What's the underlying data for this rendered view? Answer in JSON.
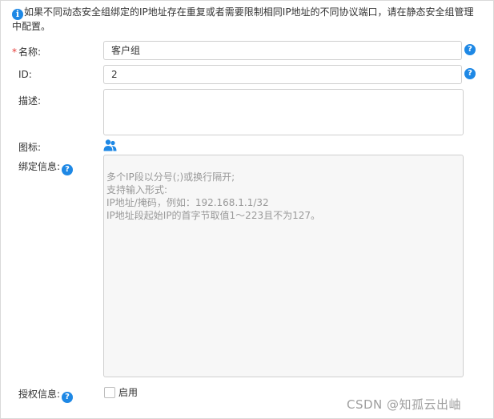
{
  "notice": {
    "text": "如果不同动态安全组绑定的IP地址存在重复或者需要限制相同IP地址的不同协议端口，请在静态安全组管理中配置。"
  },
  "form": {
    "name": {
      "required_mark": "*",
      "label": "名称:",
      "value": "客户组"
    },
    "id": {
      "label": "ID:",
      "value": "2"
    },
    "description": {
      "label": "描述:",
      "value": ""
    },
    "icon": {
      "label": "图标:",
      "icon_name": "user-group-icon"
    },
    "binding": {
      "label": "绑定信息:",
      "placeholder": "多个IP段以分号(;)或换行隔开;\n支持输入形式:\nIP地址/掩码，例如：192.168.1.1/32\nIP地址段起始IP的首字节取值1～223且不为127。"
    },
    "auth": {
      "label": "授权信息:",
      "checkbox_label": "启用",
      "checked": false
    }
  },
  "help_glyph": "?",
  "info_glyph": "i",
  "colors": {
    "accent": "#1e88e5",
    "required": "#e53935",
    "placeholder": "#999999"
  },
  "watermark": "CSDN @知孤云出岫"
}
